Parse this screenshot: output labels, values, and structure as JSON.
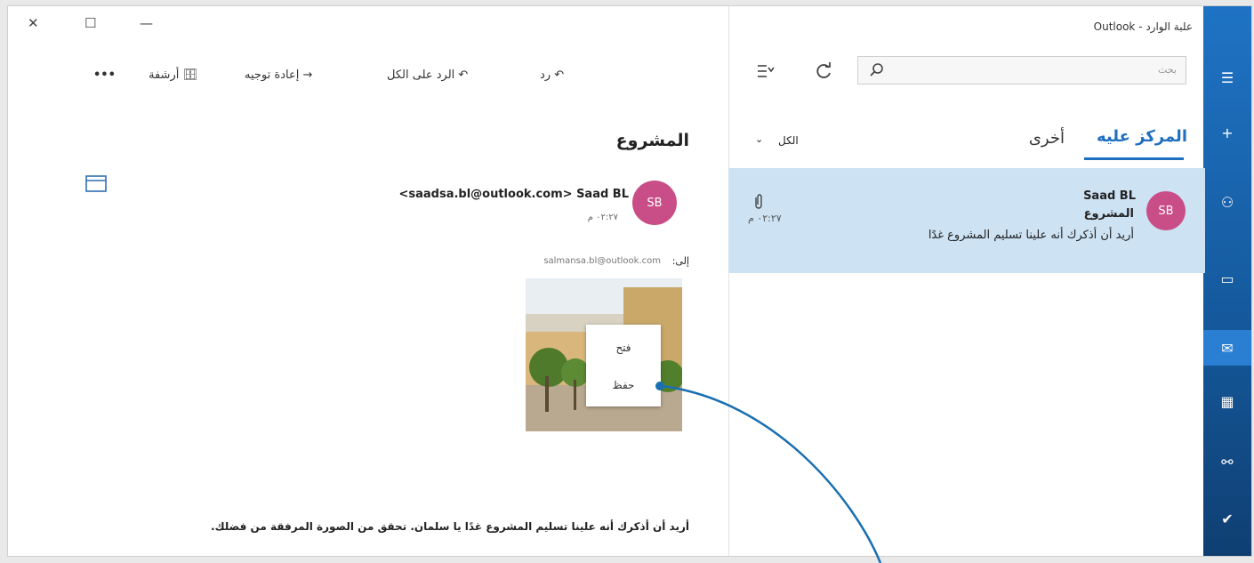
{
  "window": {
    "title": "علبة الوارد - Outlook",
    "close": "✕",
    "maximize": "☐",
    "minimize": "—"
  },
  "rail": {
    "items": [
      "☰",
      "+",
      "⚇",
      "▭",
      "✉",
      "▦",
      "⚯",
      "✔"
    ]
  },
  "search": {
    "placeholder": "بحث"
  },
  "tabs": {
    "focused": "المركز عليه",
    "other": "أخرى",
    "filter": "الكل"
  },
  "message_list": [
    {
      "sender": "Saad BL",
      "subject": "المشروع",
      "preview": "أريد أن أذكرك أنه علينا تسليم المشروع غدًا",
      "time": "٠٢:٢٧ م",
      "avatar": "SB"
    }
  ],
  "toolbar": {
    "reply": "رد",
    "reply_all": "الرد على الكل",
    "forward": "إعادة توجيه",
    "archive": "أرشفة",
    "more": "•••"
  },
  "reading": {
    "subject": "المشروع",
    "from": "<saadsa.bl@outlook.com> Saad BL",
    "avatar": "SB",
    "time": "٠٢:٢٧ م",
    "to_label": "إلى:",
    "to_value": "salmansa.bl@outlook.com",
    "body": "أريد أن أذكرك أنه علينا تسليم المشروع غدًا يا سلمان. تحقق من الصورة المرفقة من فضلك."
  },
  "context_menu": {
    "open": "فتح",
    "save": "حفظ"
  },
  "colors": {
    "accent": "#1f73c4",
    "avatar": "#c94d86",
    "selected": "#cde2f3",
    "callout": "#1a6fb0"
  }
}
